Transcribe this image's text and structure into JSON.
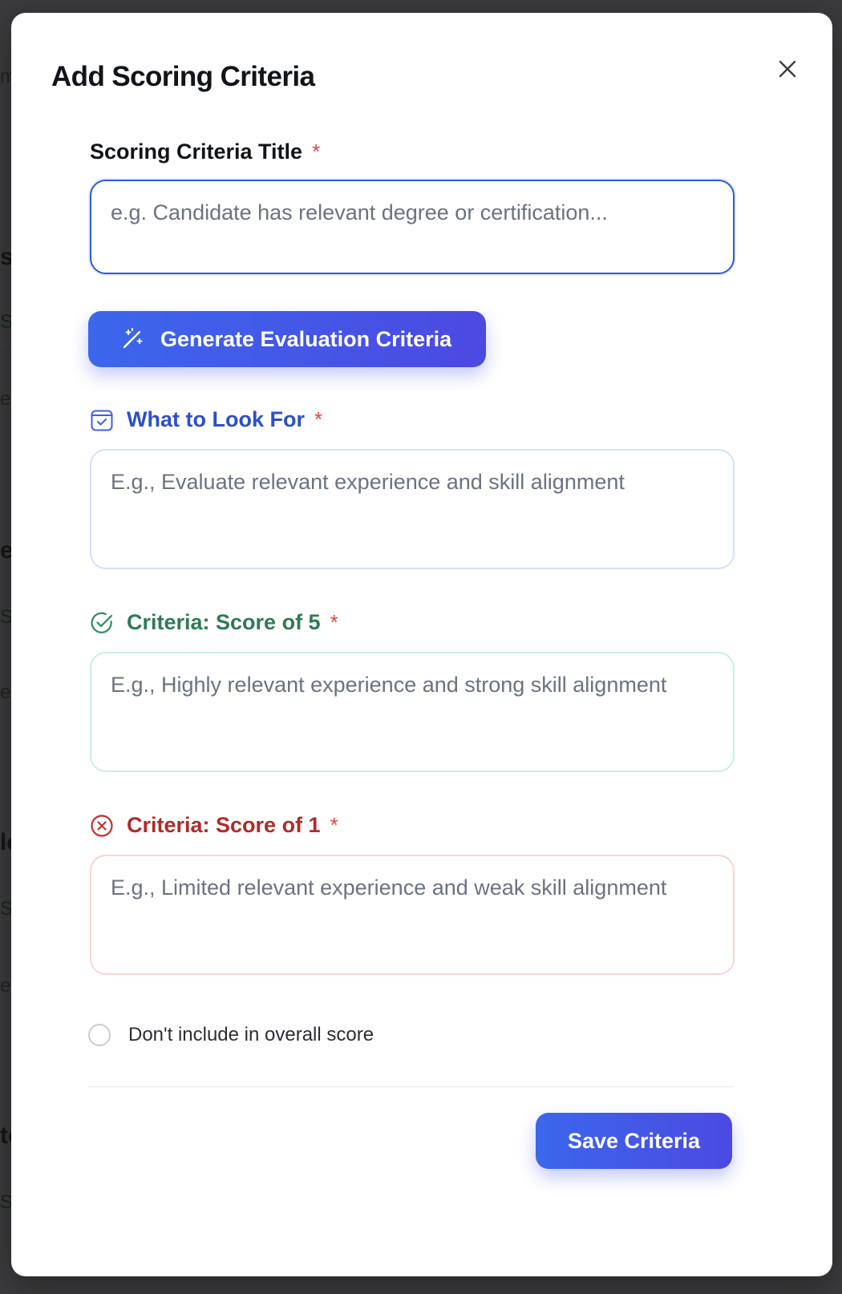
{
  "modal": {
    "title": "Add Scoring Criteria"
  },
  "fields": {
    "title": {
      "label": "Scoring Criteria Title",
      "required_mark": "*",
      "placeholder": "e.g. Candidate has relevant degree or certification...",
      "value": ""
    },
    "look_for": {
      "label": "What to Look For",
      "required_mark": "*",
      "placeholder": "E.g., Evaluate relevant experience and skill alignment",
      "value": "",
      "color": "#2d4fc8",
      "icon": "checklist-icon"
    },
    "score_five": {
      "label": "Criteria: Score of 5",
      "required_mark": "*",
      "placeholder": "E.g., Highly relevant experience and strong skill alignment",
      "value": "",
      "color": "#2f7a55",
      "icon": "check-circle-icon"
    },
    "score_one": {
      "label": "Criteria: Score of 1",
      "required_mark": "*",
      "placeholder": "E.g., Limited relevant experience and weak skill alignment",
      "value": "",
      "color": "#b02a2a",
      "icon": "x-circle-icon"
    }
  },
  "generate_button": {
    "label": "Generate Evaluation Criteria",
    "icon": "magic-wand-icon"
  },
  "exclude_checkbox": {
    "label": "Don't include in overall score",
    "checked": false
  },
  "save_button": {
    "label": "Save Criteria"
  },
  "colors": {
    "accent": "#3b5fe8",
    "required": "#e0463c"
  },
  "backdrop": {
    "fragments": [
      "m",
      "s",
      "Sc",
      "er",
      "e",
      "Sc",
      "er",
      "le",
      "Sc",
      "er",
      "tc",
      "Sc",
      "c"
    ]
  }
}
